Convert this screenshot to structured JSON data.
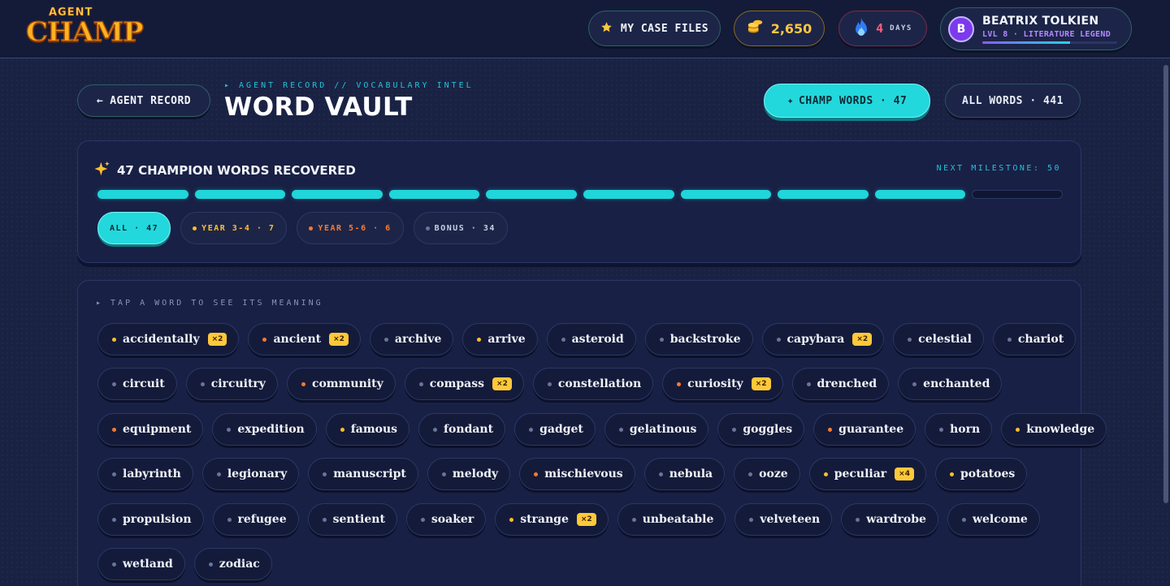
{
  "topbar": {
    "logo_top": "AGENT",
    "logo_bottom": "CHAMP",
    "case_files_label": "MY CASE FILES",
    "coins": "2,650",
    "streak_number": "4",
    "streak_unit": "DAYS",
    "user": {
      "initial": "B",
      "name": "BEATRIX TOLKIEN",
      "level": "LVL 8 · LITERATURE LEGEND",
      "xp_progress": 0.65
    }
  },
  "header": {
    "back_label": "AGENT RECORD",
    "breadcrumb": "▸ AGENT RECORD // VOCABULARY INTEL",
    "title": "WORD VAULT",
    "champ_words_label": "CHAMP WORDS · 47",
    "all_words_label": "ALL WORDS · 441"
  },
  "stats": {
    "headline": "47 CHAMPION WORDS RECOVERED",
    "milestone": "NEXT MILESTONE: 50",
    "segments_total": 10,
    "segments_filled": 9,
    "filters": [
      {
        "label": "ALL · 47",
        "active": true,
        "color": "#0b2a35",
        "dot": ""
      },
      {
        "label": "YEAR 3-4 · 7",
        "active": false,
        "color": "#ffbf2e",
        "dot": "#ffbf2e"
      },
      {
        "label": "YEAR 5-6 · 6",
        "active": false,
        "color": "#ff7a2a",
        "dot": "#ff7a2a"
      },
      {
        "label": "BONUS · 34",
        "active": false,
        "color": "#c9cfe3",
        "dot": "#6b7496"
      }
    ]
  },
  "words": {
    "hint": "▸ TAP A WORD TO SEE ITS MEANING",
    "rows": [
      [
        {
          "word": "accidentally",
          "tier": "y",
          "badge": "×2"
        },
        {
          "word": "ancient",
          "tier": "o",
          "badge": "×2"
        },
        {
          "word": "archive",
          "tier": "b",
          "badge": ""
        },
        {
          "word": "arrive",
          "tier": "y",
          "badge": ""
        },
        {
          "word": "asteroid",
          "tier": "b",
          "badge": ""
        },
        {
          "word": "backstroke",
          "tier": "b",
          "badge": ""
        },
        {
          "word": "capybara",
          "tier": "b",
          "badge": "×2"
        },
        {
          "word": "celestial",
          "tier": "b",
          "badge": ""
        },
        {
          "word": "chariot",
          "tier": "b",
          "badge": ""
        }
      ],
      [
        {
          "word": "circuit",
          "tier": "b",
          "badge": ""
        },
        {
          "word": "circuitry",
          "tier": "b",
          "badge": ""
        },
        {
          "word": "community",
          "tier": "o",
          "badge": ""
        },
        {
          "word": "compass",
          "tier": "b",
          "badge": "×2"
        },
        {
          "word": "constellation",
          "tier": "b",
          "badge": ""
        },
        {
          "word": "curiosity",
          "tier": "o",
          "badge": "×2"
        },
        {
          "word": "drenched",
          "tier": "b",
          "badge": ""
        },
        {
          "word": "enchanted",
          "tier": "b",
          "badge": ""
        }
      ],
      [
        {
          "word": "equipment",
          "tier": "o",
          "badge": ""
        },
        {
          "word": "expedition",
          "tier": "b",
          "badge": ""
        },
        {
          "word": "famous",
          "tier": "y",
          "badge": ""
        },
        {
          "word": "fondant",
          "tier": "b",
          "badge": ""
        },
        {
          "word": "gadget",
          "tier": "b",
          "badge": ""
        },
        {
          "word": "gelatinous",
          "tier": "b",
          "badge": ""
        },
        {
          "word": "goggles",
          "tier": "b",
          "badge": ""
        },
        {
          "word": "guarantee",
          "tier": "o",
          "badge": ""
        },
        {
          "word": "horn",
          "tier": "b",
          "badge": ""
        },
        {
          "word": "knowledge",
          "tier": "y",
          "badge": ""
        }
      ],
      [
        {
          "word": "labyrinth",
          "tier": "b",
          "badge": ""
        },
        {
          "word": "legionary",
          "tier": "b",
          "badge": ""
        },
        {
          "word": "manuscript",
          "tier": "b",
          "badge": ""
        },
        {
          "word": "melody",
          "tier": "b",
          "badge": ""
        },
        {
          "word": "mischievous",
          "tier": "o",
          "badge": ""
        },
        {
          "word": "nebula",
          "tier": "b",
          "badge": ""
        },
        {
          "word": "ooze",
          "tier": "b",
          "badge": ""
        },
        {
          "word": "peculiar",
          "tier": "y",
          "badge": "×4"
        },
        {
          "word": "potatoes",
          "tier": "y",
          "badge": ""
        }
      ],
      [
        {
          "word": "propulsion",
          "tier": "b",
          "badge": ""
        },
        {
          "word": "refugee",
          "tier": "b",
          "badge": ""
        },
        {
          "word": "sentient",
          "tier": "b",
          "badge": ""
        },
        {
          "word": "soaker",
          "tier": "b",
          "badge": ""
        },
        {
          "word": "strange",
          "tier": "y",
          "badge": "×2"
        },
        {
          "word": "unbeatable",
          "tier": "b",
          "badge": ""
        },
        {
          "word": "velveteen",
          "tier": "b",
          "badge": ""
        },
        {
          "word": "wardrobe",
          "tier": "b",
          "badge": ""
        },
        {
          "word": "welcome",
          "tier": "b",
          "badge": ""
        }
      ],
      [
        {
          "word": "wetland",
          "tier": "b",
          "badge": ""
        },
        {
          "word": "zodiac",
          "tier": "b",
          "badge": ""
        }
      ]
    ]
  },
  "colors": {
    "accent": "#22d8dc",
    "coin": "#ffc640",
    "streak": "#ff5f7a",
    "purple": "#b388ff",
    "year34": "#ffbf2e",
    "year56": "#ff7a2a"
  }
}
